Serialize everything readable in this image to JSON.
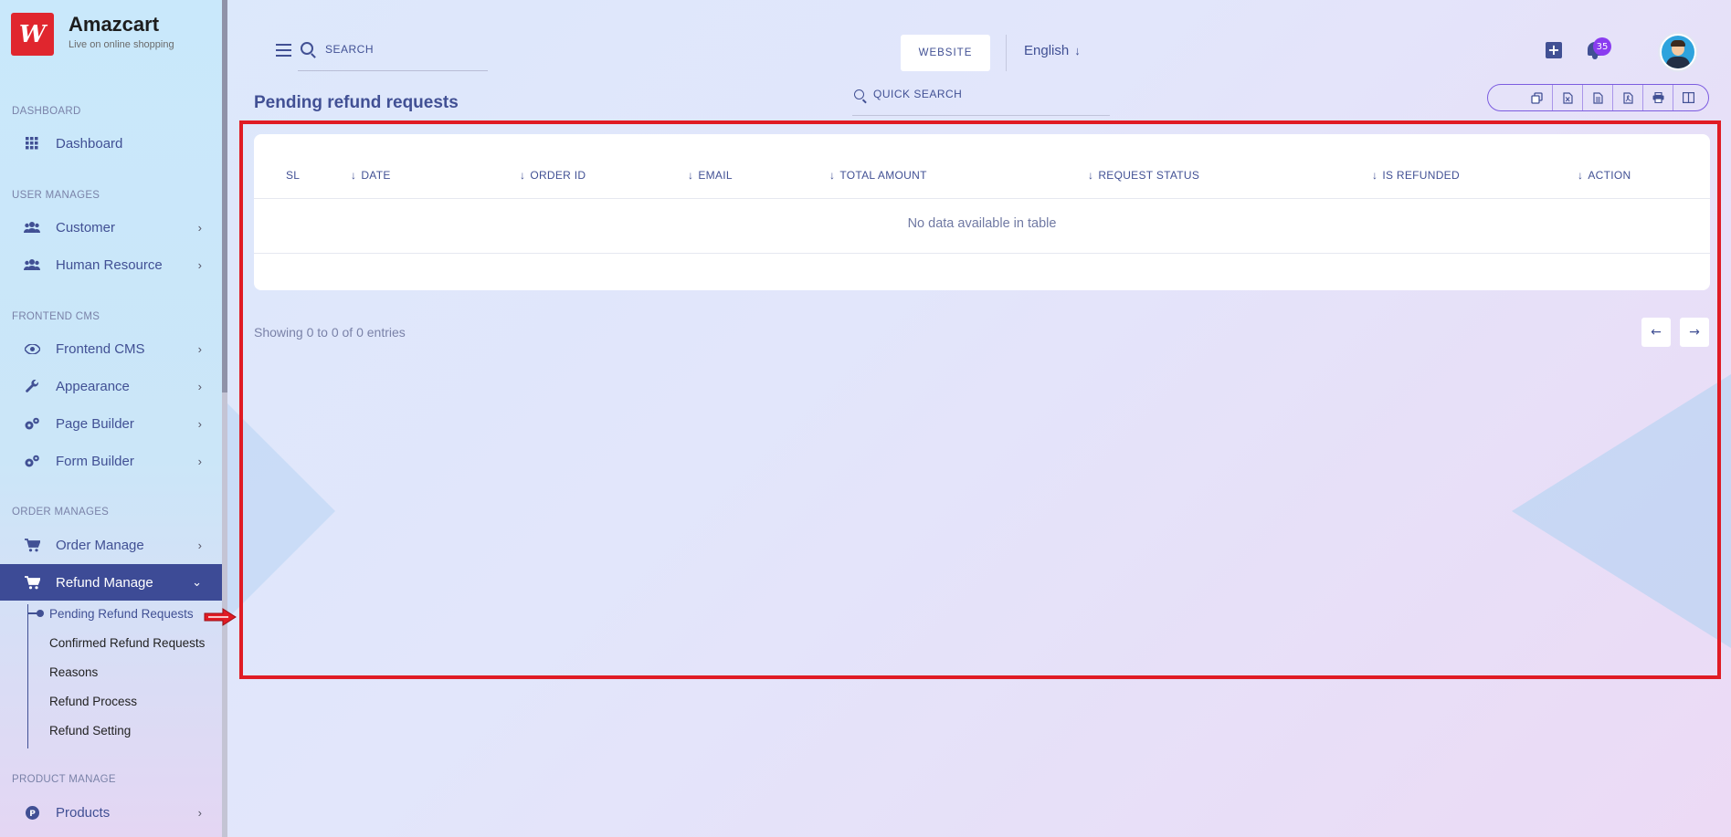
{
  "brand": {
    "name": "Amazcart",
    "tagline": "Live on online shopping",
    "logo_text": "W"
  },
  "sidebar": {
    "sections": {
      "dashboard": "DASHBOARD",
      "user_manages": "USER MANAGES",
      "frontend_cms": "FRONTEND CMS",
      "order_manages": "ORDER MANAGES",
      "product_manage": "PRODUCT MANAGE"
    },
    "items": {
      "dashboard": "Dashboard",
      "customer": "Customer",
      "human_resource": "Human Resource",
      "frontend_cms": "Frontend CMS",
      "appearance": "Appearance",
      "page_builder": "Page Builder",
      "form_builder": "Form Builder",
      "order_manage": "Order Manage",
      "refund_manage": "Refund Manage",
      "products": "Products"
    },
    "refund_sub": {
      "pending": "Pending Refund Requests",
      "confirmed": "Confirmed Refund Requests",
      "reasons": "Reasons",
      "process": "Refund Process",
      "setting": "Refund Setting"
    },
    "chevron_right": "›",
    "chevron_down": "⌄"
  },
  "header": {
    "search_placeholder": "SEARCH",
    "website_label": "WEBSITE",
    "language": "English",
    "language_arrow": "↓",
    "notification_count": "35"
  },
  "page": {
    "title": "Pending refund requests",
    "quick_search_placeholder": "QUICK SEARCH"
  },
  "table": {
    "columns": {
      "sl": "SL",
      "date": "DATE",
      "order_id": "ORDER ID",
      "email": "EMAIL",
      "total_amount": "TOTAL AMOUNT",
      "request_status": "REQUEST STATUS",
      "is_refunded": "IS REFUNDED",
      "action": "ACTION"
    },
    "sort_arrow": "↓",
    "empty_message": "No data available in table",
    "info": "Showing 0 to 0 of 0 entries",
    "prev": "←",
    "next": "→"
  },
  "colors": {
    "accent": "#415094",
    "active_nav": "#3d4b96",
    "badge": "#8a3cf0",
    "highlight": "#e01b24",
    "brand_logo": "#e0262e"
  }
}
